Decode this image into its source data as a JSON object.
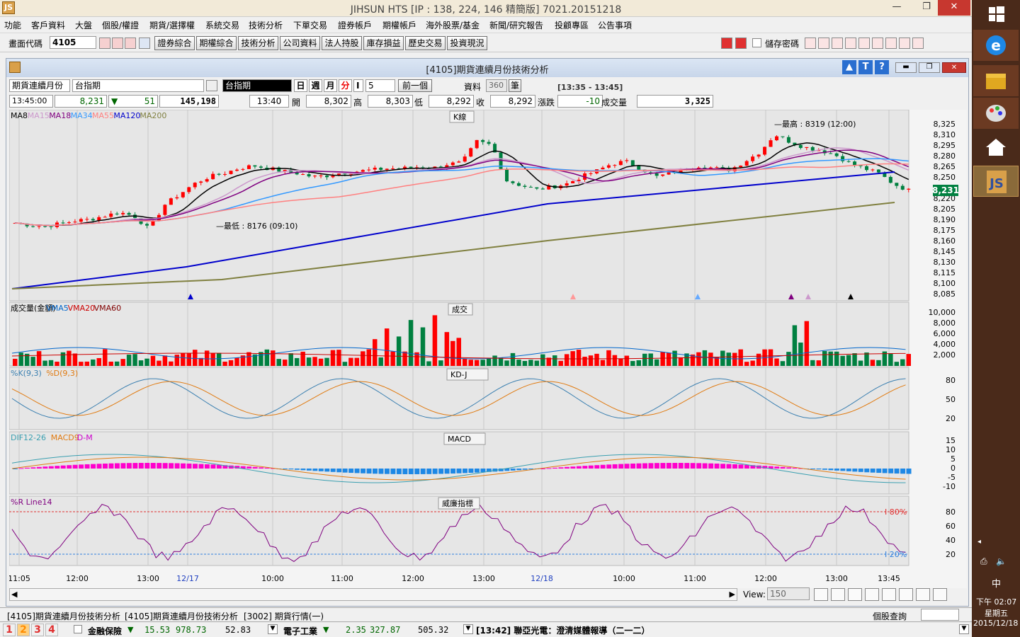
{
  "window": {
    "title": "JIHSUN HTS    [IP : 138, 224, 146 精簡版] 7021.20151218"
  },
  "menu": [
    "功能",
    "客戶資料",
    "大盤",
    "個股/權證",
    "期貨/選擇權",
    "系統交易",
    "技術分析",
    "下單交易",
    "證券帳戶",
    "期權帳戶",
    "海外股票/基金",
    "新聞/研究報告",
    "投顧專區",
    "公告事項"
  ],
  "toolbar": {
    "code_label": "畫面代碼",
    "code_value": "4105",
    "buttons": [
      "證券綜合",
      "期權綜合",
      "技術分析",
      "公司資料",
      "法人持股",
      "庫存損益",
      "歷史交易",
      "投資現況"
    ],
    "save_password": "儲存密碼"
  },
  "chart_window": {
    "title": "[4105]期貨連續月份技術分析",
    "product_type": "期貨連續月份",
    "product": "台指期",
    "symbol_display": "台指期",
    "periods": [
      "日",
      "週",
      "月",
      "分"
    ],
    "period_selected": "分",
    "interval": "5",
    "prev_label": "前一個",
    "data_label": "資料",
    "data_count": "360",
    "data_unit": "筆",
    "time_range": "[13:35 - 13:45]",
    "quote": {
      "time": "13:45:00",
      "price": "8,231",
      "change": "51",
      "volume": "145,198",
      "bar_time": "13:40",
      "open_label": "開",
      "open": "8,302",
      "high_label": "高",
      "high": "8,303",
      "low_label": "低",
      "low": "8,292",
      "close_label": "收",
      "close": "8,292",
      "chg_label": "漲跌",
      "chg": "-10",
      "vol_label": "成交量",
      "vol": "3,325"
    },
    "view_label": "View:",
    "view_value": "150"
  },
  "panels": {
    "kline": {
      "title": "K線",
      "ma_legend": [
        {
          "name": "MA8",
          "color": "#000000"
        },
        {
          "name": "MA15",
          "color": "#cc99cc"
        },
        {
          "name": "MA18",
          "color": "#800080"
        },
        {
          "name": "MA34",
          "color": "#3399ff"
        },
        {
          "name": "MA55",
          "color": "#ff8080"
        },
        {
          "name": "MA120",
          "color": "#0000cc"
        },
        {
          "name": "MA200",
          "color": "#808040"
        }
      ],
      "yticks": [
        "8,325",
        "8,310",
        "8,295",
        "8,280",
        "8,265",
        "8,250",
        "8,235",
        "8,220",
        "8,205",
        "8,190",
        "8,175",
        "8,160",
        "8,145",
        "8,130",
        "8,115",
        "8,100",
        "8,085"
      ],
      "high_note": "最高 : 8319 (12:00)",
      "low_note": "最低 : 8176 (09:10)",
      "last_price": "8,231"
    },
    "volume": {
      "title": "成交",
      "legend": [
        {
          "name": "成交量(金額)",
          "color": "#000000"
        },
        {
          "name": "VMA5",
          "color": "#0066cc"
        },
        {
          "name": "VMA20",
          "color": "#cc0000"
        },
        {
          "name": "VMA60",
          "color": "#800000"
        }
      ],
      "yticks": [
        "10,000",
        "8,000",
        "6,000",
        "4,000",
        "2,000"
      ]
    },
    "kdj": {
      "title": "KD-J",
      "legend": [
        {
          "name": "%K(9,3)",
          "color": "#3a7fb0"
        },
        {
          "name": "%D(9,3)",
          "color": "#e07a10"
        }
      ],
      "yticks": [
        "80",
        "50",
        "20"
      ]
    },
    "macd": {
      "title": "MACD",
      "legend": [
        {
          "name": "DIF12-26",
          "color": "#3a9fb0"
        },
        {
          "name": "MACD9",
          "color": "#e07a10"
        },
        {
          "name": "D-M",
          "color": "#cc00cc"
        }
      ],
      "yticks": [
        "15",
        "10",
        "5",
        "0",
        "-5",
        "-10"
      ]
    },
    "wr": {
      "title": "威廉指標",
      "legend": [
        {
          "name": "%R Line14",
          "color": "#800080"
        }
      ],
      "yticks": [
        "80",
        "60",
        "40",
        "20"
      ],
      "upper_line": "I 80%",
      "lower_line": "I 20%"
    }
  },
  "xaxis": [
    {
      "label": "11:05",
      "special": false
    },
    {
      "label": "12:00",
      "special": false
    },
    {
      "label": "13:00",
      "special": false
    },
    {
      "label": "12/17",
      "special": true
    },
    {
      "label": "10:00",
      "special": false
    },
    {
      "label": "11:00",
      "special": false
    },
    {
      "label": "12:00",
      "special": false
    },
    {
      "label": "13:00",
      "special": false
    },
    {
      "label": "12/18",
      "special": true
    },
    {
      "label": "10:00",
      "special": false
    },
    {
      "label": "11:00",
      "special": false
    },
    {
      "label": "12:00",
      "special": false
    },
    {
      "label": "13:00",
      "special": false
    },
    {
      "label": "13:45",
      "special": false
    }
  ],
  "tabs": [
    "[4105]期貨連續月份技術分析",
    "[4105]期貨連續月份技術分析",
    "[3002] 期貨行情(一)"
  ],
  "stock_query_label": "個股查詢",
  "status": {
    "pages": [
      "1",
      "2",
      "3",
      "4"
    ],
    "sector1": "金融保險",
    "s1_chg": "15.53",
    "s1_val": "978.73",
    "s1_vol": "52.83",
    "sector2": "電子工業",
    "s2_chg": "2.35",
    "s2_val": "327.87",
    "s2_vol": "505.32",
    "news": "[13:42] 聯亞光電：澄清媒體報導（二一二）"
  },
  "taskbar": {
    "ime": "中",
    "time": "下午 02:07",
    "weekday": "星期五",
    "date": "2015/12/18"
  },
  "colors": {
    "up": "#ff0000",
    "down": "#008040",
    "bg": "#e6e6e6"
  }
}
